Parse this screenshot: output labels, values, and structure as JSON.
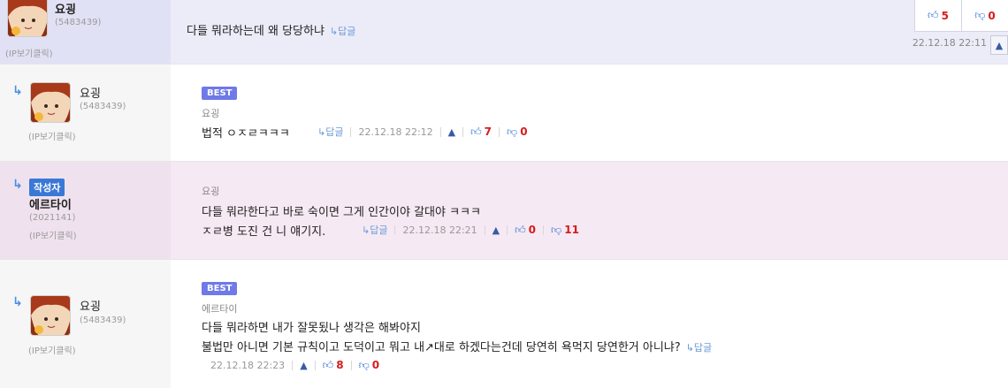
{
  "ui": {
    "reply_arrow": "↳",
    "reply_label": "↳답글",
    "thumb_up_icon": "thumb-up-icon",
    "thumb_down_icon": "thumb-down-icon",
    "bell_icon": "bell-icon",
    "accent_color": "#3a78d6",
    "count_color": "#d81b1b",
    "best_badge_color": "#6f79e8"
  },
  "top_comment": {
    "nick": "요굉",
    "uid": "(5483439)",
    "ip": "(IP보기클릭)",
    "text": "다들 뭐라하는데 왜 당당하냐",
    "reply": "↳답글",
    "up": "5",
    "down": "0",
    "date": "22.12.18 22:11"
  },
  "comments": [
    {
      "badge": "BEST",
      "nick": "요굉",
      "uid": "(5483439)",
      "ip": "(IP보기클릭)",
      "mention": "요굉",
      "lines": [
        "법적 ㅇㅈㄹㅋㅋㅋ"
      ],
      "reply": "↳답글",
      "date": "22.12.18 22:12",
      "up": "7",
      "down": "0"
    },
    {
      "author_badge": "작성자",
      "nick": "에르타이",
      "uid": "(2021141)",
      "ip": "(IP보기클릭)",
      "mention": "요굉",
      "lines": [
        "다들 뭐라한다고 바로 숙이면 그게 인간이야 갈대야 ㅋㅋㅋ",
        "ㅈㄹ병 도진 건 니 얘기지."
      ],
      "reply": "↳답글",
      "date": "22.12.18 22:21",
      "up": "0",
      "down": "11"
    },
    {
      "badge": "BEST",
      "nick": "요굉",
      "uid": "(5483439)",
      "ip": "(IP보기클릭)",
      "mention": "에르타이",
      "lines": [
        "다들 뭐라하면 내가 잘못됬나 생각은 해봐야지",
        "불법만 아니면 기본 규칙이고 도덕이고 뭐고 내↗대로 하겠다는건데 당연히 욕먹지 당연한거 아니냐?"
      ],
      "reply": "↳답글",
      "date": "22.12.18 22:23",
      "up": "8",
      "down": "0"
    }
  ]
}
